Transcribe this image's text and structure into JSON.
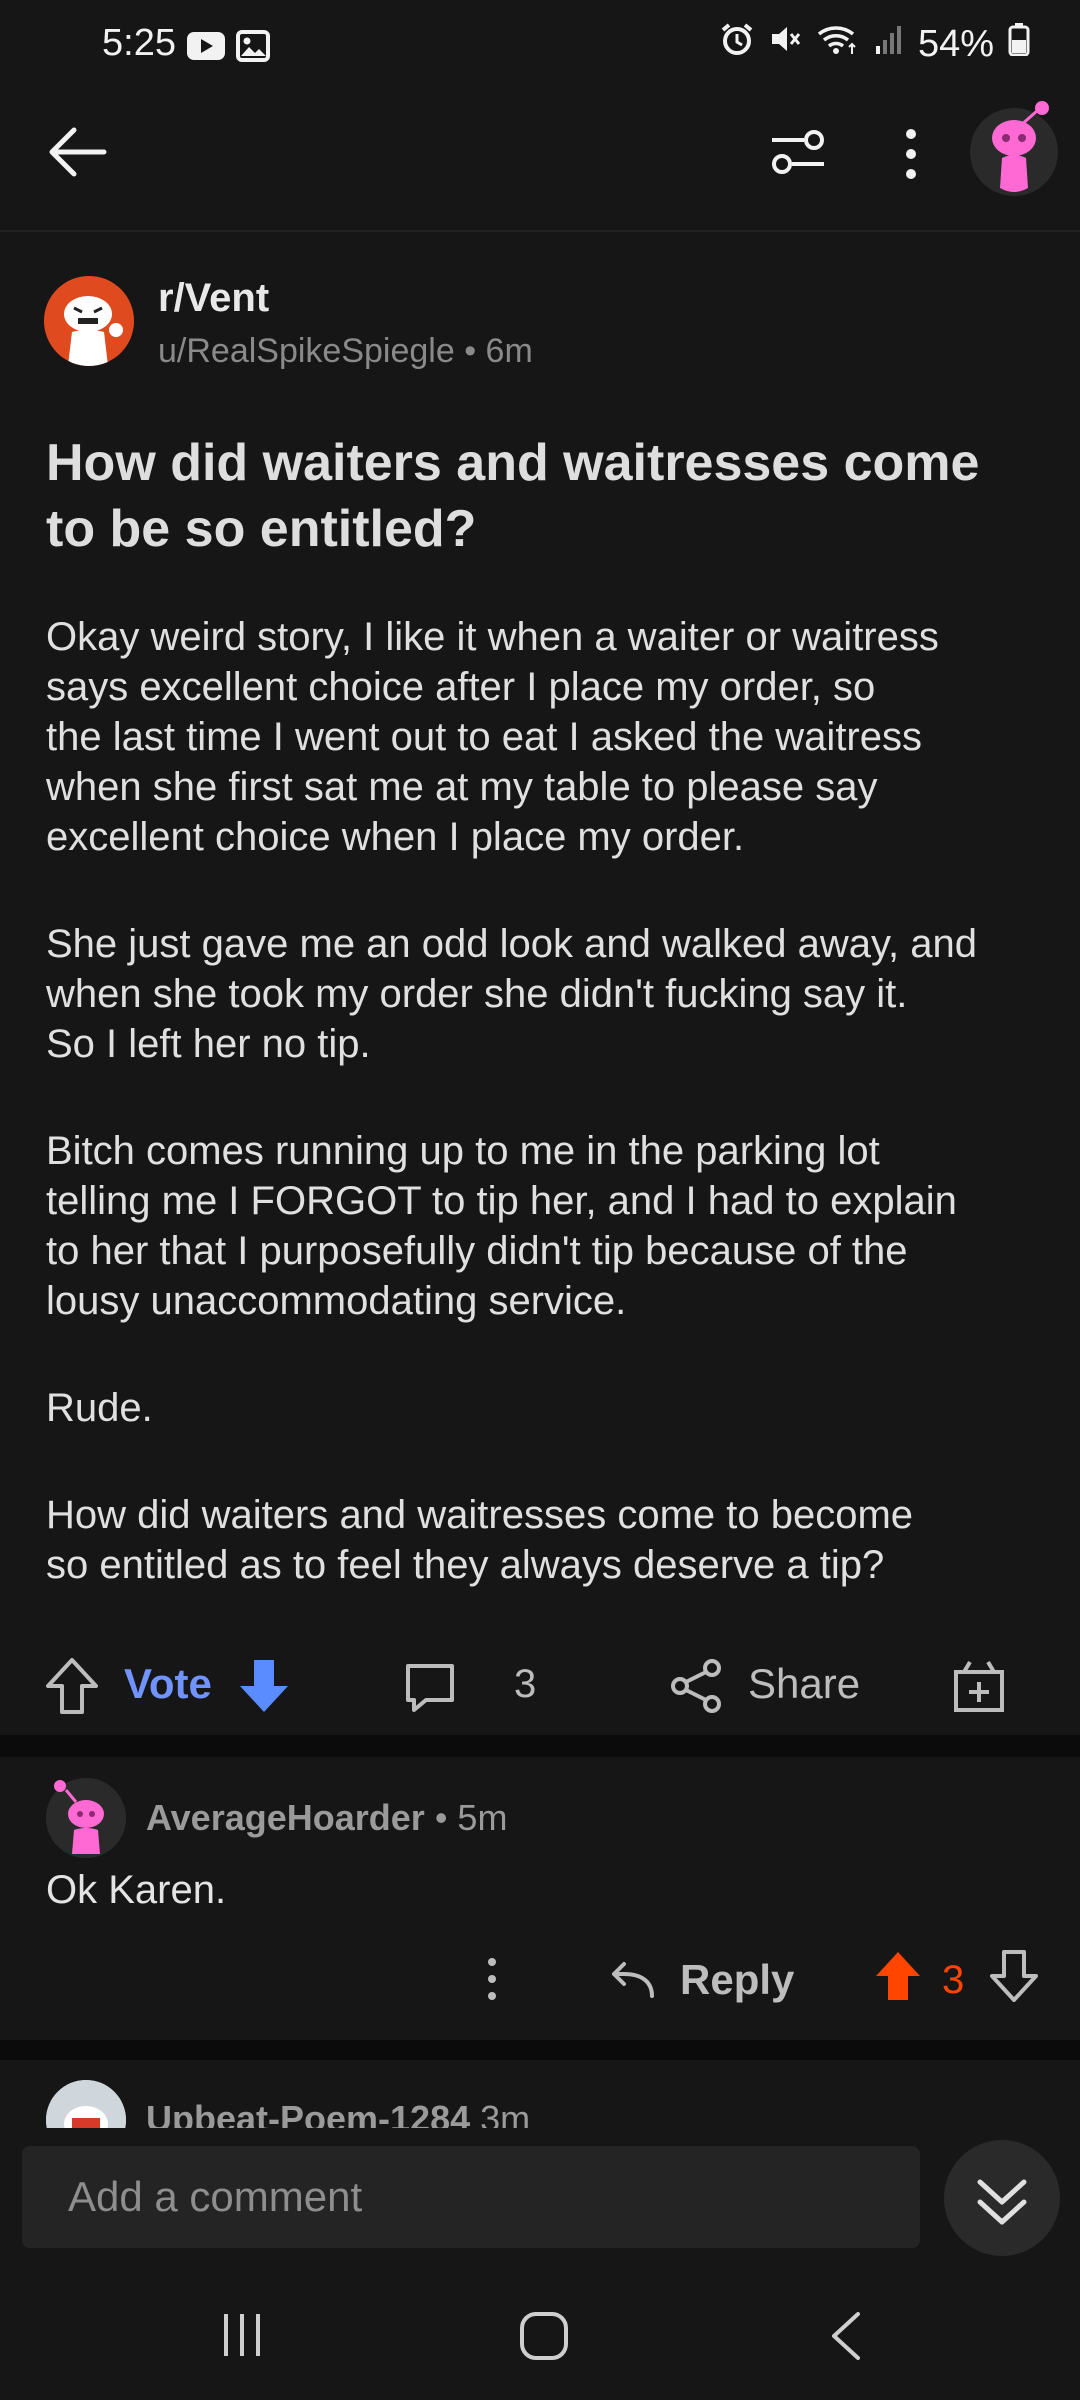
{
  "status": {
    "time": "5:25",
    "battery": "54%",
    "icons": [
      "youtube-icon",
      "gallery-icon",
      "alarm-icon",
      "mute-icon",
      "wifi-icon",
      "signal-icon",
      "battery-icon"
    ]
  },
  "topbar": {
    "icons": [
      "back-arrow-icon",
      "filter-icon",
      "more-vertical-icon",
      "user-avatar"
    ]
  },
  "post": {
    "subreddit": "r/Vent",
    "meta": "u/RealSpikeSpiegle • 6m",
    "title": "How did waiters and waitresses come to be so entitled?",
    "paragraphs": [
      "Okay weird story, I like it when a waiter or waitress\nsays excellent choice after I place my order, so\nthe last time I went out to eat I asked the waitress\nwhen she first sat me at my table to please say\nexcellent choice when I place my order.",
      "She just gave me an odd look and walked away, and\nwhen she took my order she didn't fucking say it.\nSo I left her no tip.",
      "Bitch comes running up to me in the parking lot\ntelling me I FORGOT to tip her, and I had to explain\nto her that I purposefully didn't tip because of the\nlousy unaccommodating service.",
      "Rude.",
      "How did waiters and waitresses come to become\nso entitled as to feel they always deserve a tip?"
    ],
    "vote_label": "Vote",
    "comment_count": "3",
    "share_label": "Share"
  },
  "comments": [
    {
      "user": "AverageHoarder",
      "time": "5m",
      "body": "Ok Karen.",
      "reply_label": "Reply",
      "score": "3"
    },
    {
      "user": "Upbeat-Poem-1284",
      "time": "3m"
    }
  ],
  "composer": {
    "placeholder": "Add a comment"
  },
  "colors": {
    "accent_blue": "#7193ff",
    "downvote_blue": "#5b8cff",
    "upvote_orange": "#ff4500",
    "bg": "#161616"
  }
}
